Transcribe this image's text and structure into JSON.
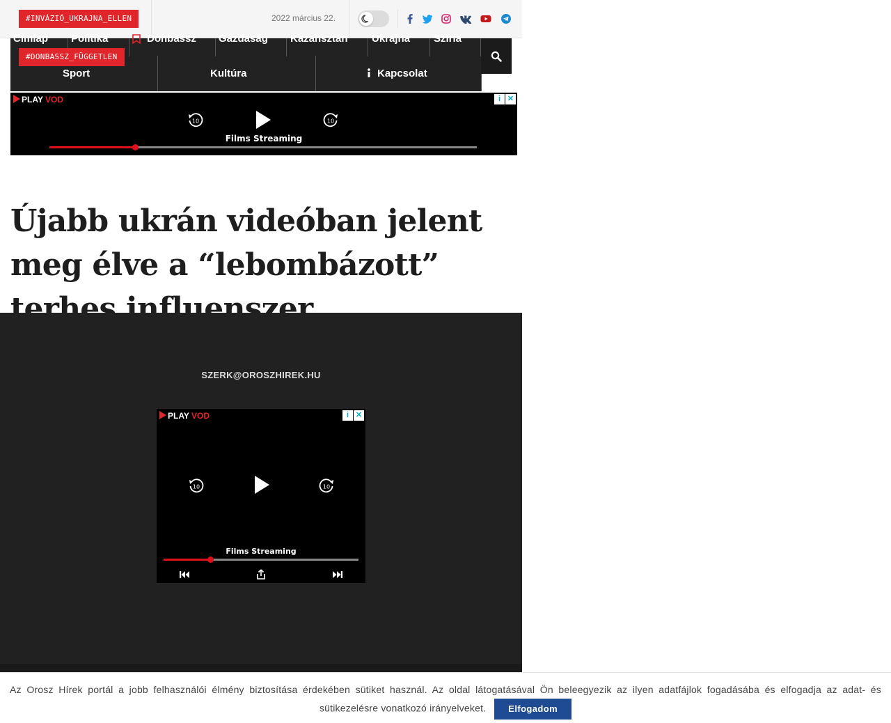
{
  "topbar": {
    "tag_primary": "#INVÁZIÓ_UKRAJNA_ELLEN",
    "tag_secondary": "#DONBASSZ_FÜGGETLEN",
    "date": "2022 március 22."
  },
  "social_icons": [
    "facebook-icon",
    "twitter-icon",
    "instagram-icon",
    "vk-icon",
    "youtube-icon",
    "telegram-icon"
  ],
  "nav": {
    "row1": [
      "Címlap",
      "Politika",
      "Donbassz",
      "Gazdaság",
      "Kazahsztán",
      "Ukrajna",
      "Szíria"
    ],
    "row2": [
      "Sport",
      "Kultúra",
      "Kapcsolat"
    ]
  },
  "ads": {
    "brand_play": "PLAY",
    "brand_vod": "VOD",
    "title": "Films Streaming",
    "top_progress": 0.2,
    "bottom_progress": 0.24
  },
  "article": {
    "headline": "Újabb ukrán videóban jelent meg élve a “lebombázott” terhes influenszer"
  },
  "footer": {
    "email": "SZERK@OROSZHIREK.HU"
  },
  "cookie": {
    "text": "Az Orosz Hírek portál a jobb felhasználói élmény biztosítása érdekében sütiket használ. Az oldal látogatásával Ön beleegyezik az ilyen adatfájlok fogadásába és elfogadja az adat- és sütikezelésre vonatkozó irányelveket.",
    "accept_label": "Elfogadom"
  },
  "colors": {
    "accent_red": "#e0252b",
    "nav_bg": "#222222",
    "footer_bg": "#212121",
    "cookie_button": "#1f4b95"
  }
}
